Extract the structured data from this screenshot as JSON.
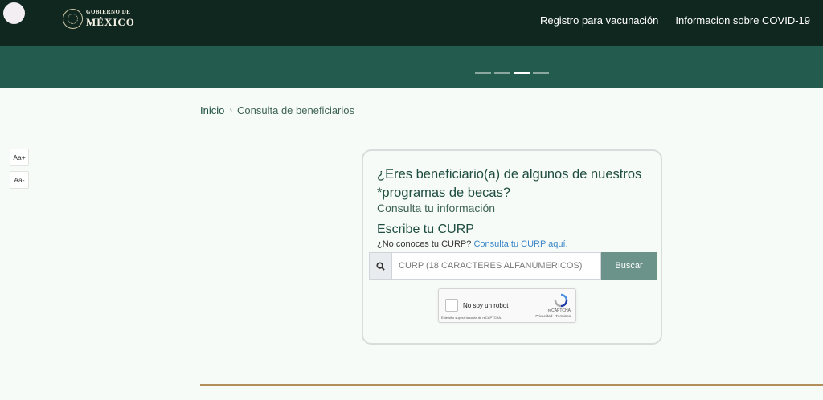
{
  "header": {
    "logo_small": "GOBIERNO DE",
    "logo_big": "MÉXICO",
    "nav": [
      "Registro para vacunación",
      "Informacion sobre COVID-19"
    ]
  },
  "carousel": {
    "slides": 4,
    "active_index": 2
  },
  "breadcrumb": {
    "home": "Inicio",
    "separator": "›",
    "current": "Consulta de beneficiarios"
  },
  "font_controls": {
    "increase": "Aa+",
    "decrease": "Aa-"
  },
  "card": {
    "question": "¿Eres beneficiario(a) de algunos de nuestros *programas de becas?",
    "subtitle": "Consulta tu información",
    "curp_title": "Escribe tu CURP",
    "help_text": "¿No conoces tu CURP?",
    "help_link": "Consulta tu CURP aquí.",
    "search_placeholder": "CURP (18 CARACTERES ALFANÚMERICOS)",
    "search_button": "Buscar"
  },
  "recaptcha": {
    "label": "No soy un robot",
    "brand": "reCAPTCHA",
    "terms": "Privacidad - Términos",
    "note": "Este sitio supera la cuota de reCAPTCHA."
  },
  "colors": {
    "header_bg": "#10271f",
    "hero_bg": "#235b4e",
    "primary_text": "#1f4d41",
    "link": "#3a86c8",
    "button": "#6b9389",
    "gold": "#b38e5d"
  },
  "icons": {
    "search": "search-icon",
    "seal": "gov-seal-icon",
    "recaptcha": "recaptcha-logo-icon"
  }
}
